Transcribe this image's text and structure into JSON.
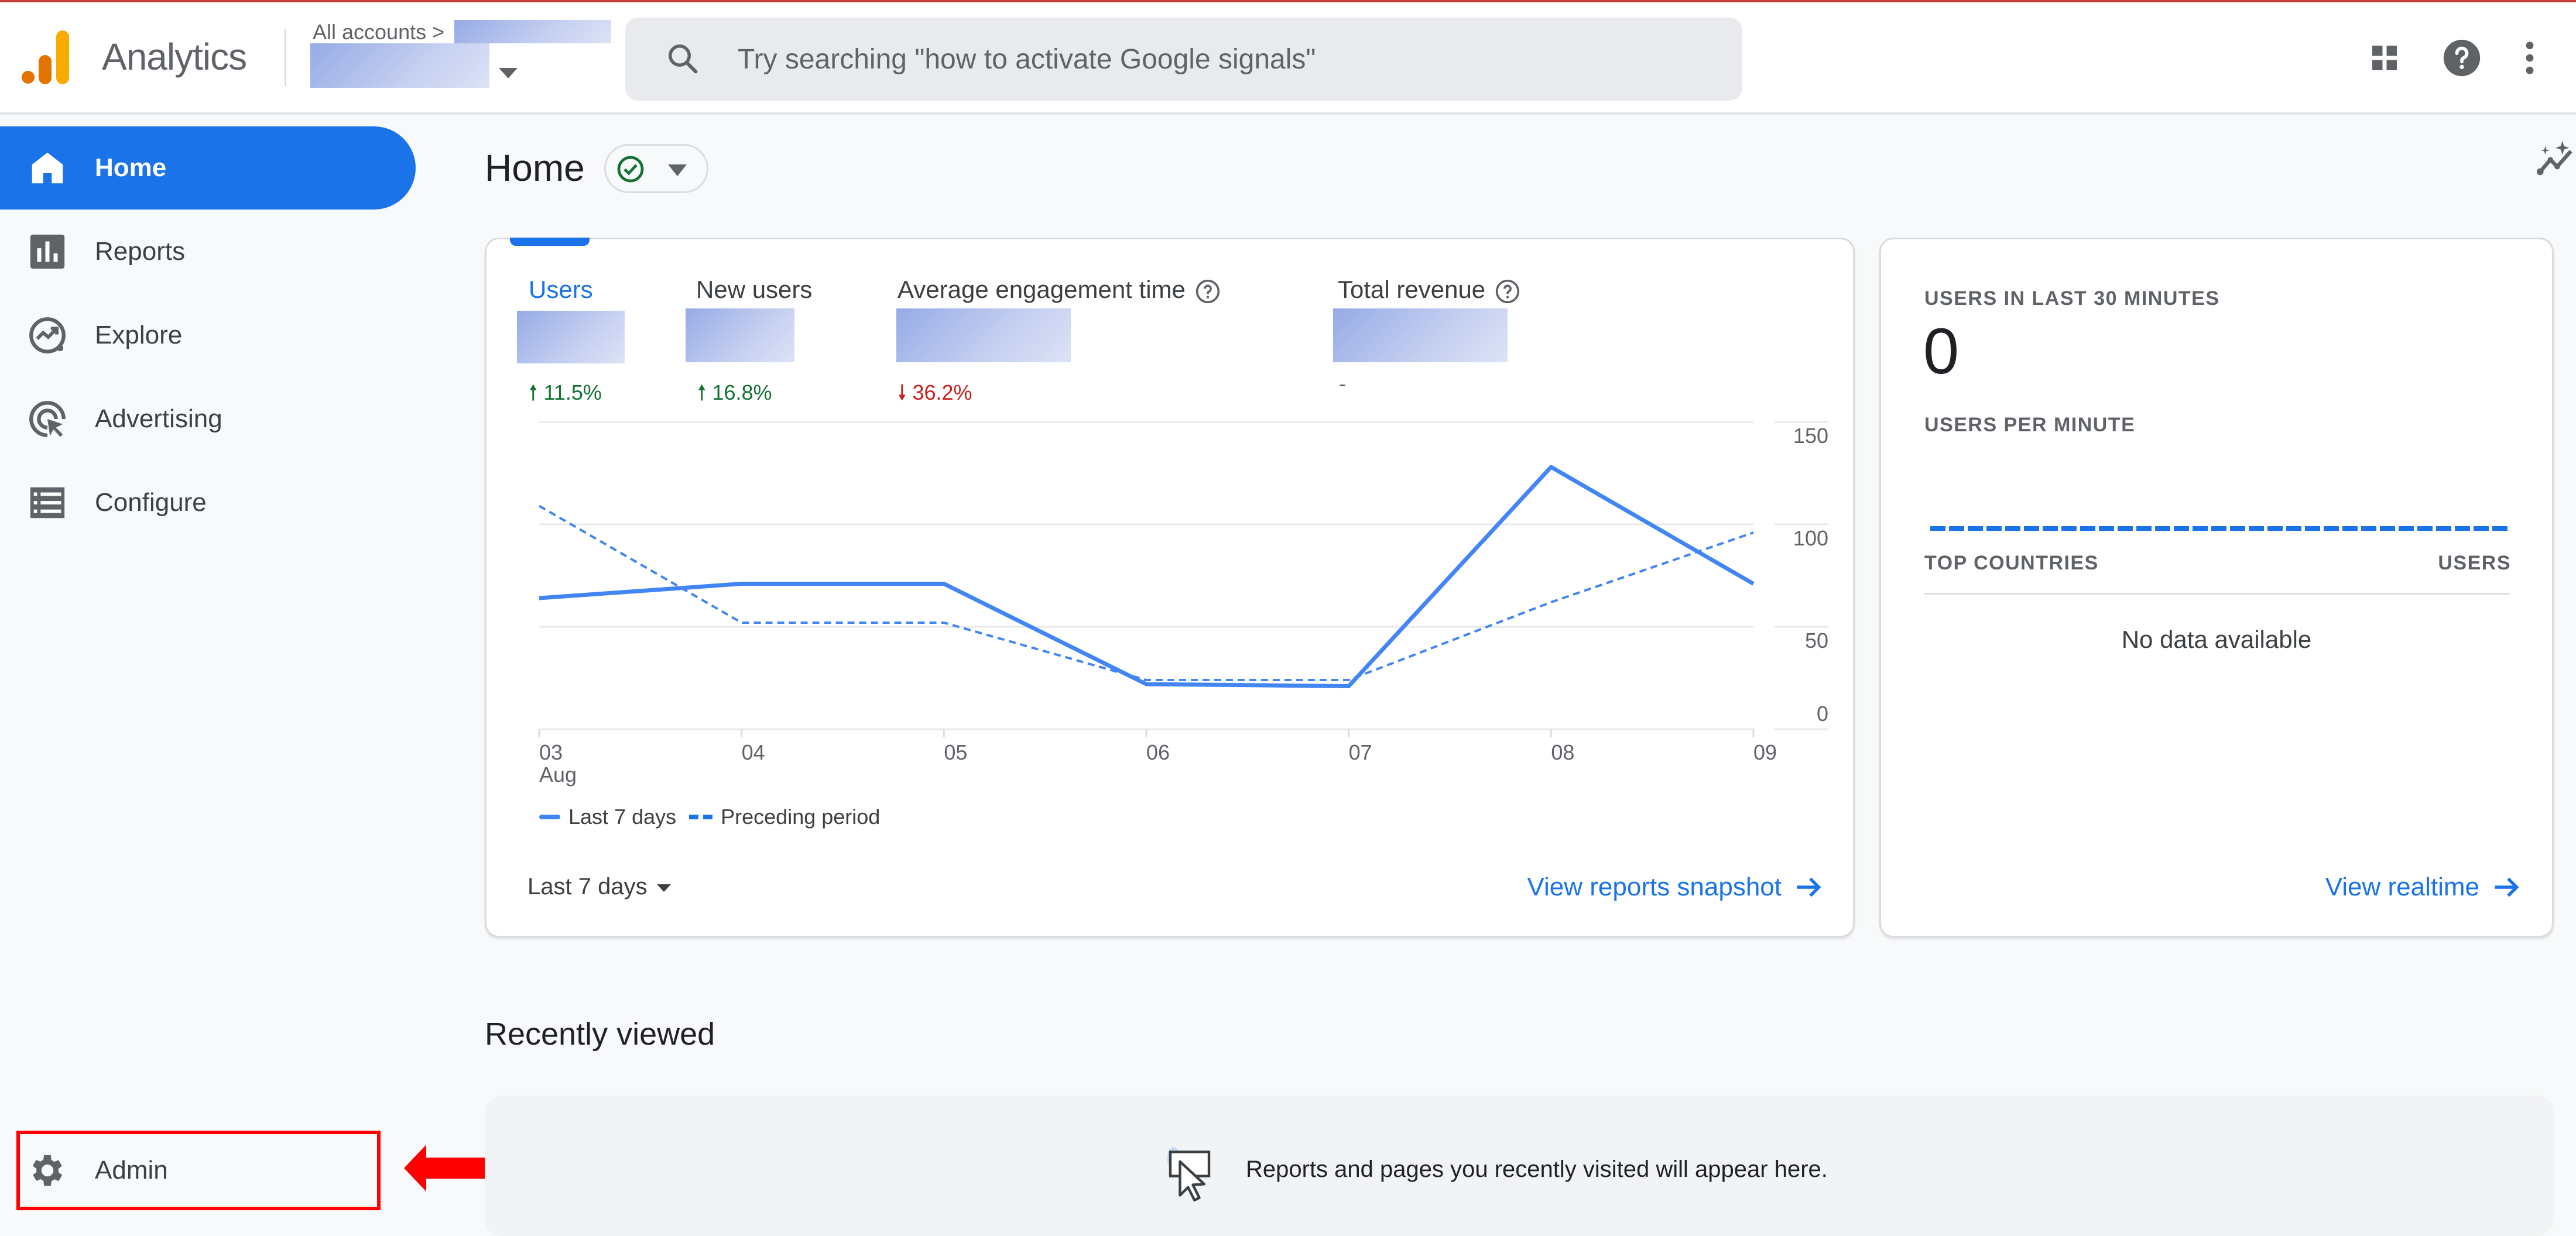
{
  "header": {
    "app_title": "Analytics",
    "breadcrumb": "All accounts >",
    "search_placeholder": "Try searching \"how to activate Google signals\"",
    "icons": [
      "apps-grid-icon",
      "help-icon",
      "more-vert-icon"
    ]
  },
  "sidebar": {
    "items": [
      {
        "label": "Home",
        "icon": "home-icon",
        "active": true
      },
      {
        "label": "Reports",
        "icon": "bar-chart-icon",
        "active": false
      },
      {
        "label": "Explore",
        "icon": "explore-icon",
        "active": false
      },
      {
        "label": "Advertising",
        "icon": "advertising-icon",
        "active": false
      },
      {
        "label": "Configure",
        "icon": "list-icon",
        "active": false
      }
    ],
    "admin": {
      "label": "Admin",
      "icon": "gear-icon"
    }
  },
  "main": {
    "title": "Home",
    "status": "check-circle-icon",
    "metrics": [
      {
        "label": "Users",
        "change": "11.5%",
        "direction": "up",
        "active": true
      },
      {
        "label": "New users",
        "change": "16.8%",
        "direction": "up",
        "active": false
      },
      {
        "label": "Average engagement time",
        "change": "36.2%",
        "direction": "down",
        "active": false,
        "help": true
      },
      {
        "label": "Total revenue",
        "change": "-",
        "direction": "none",
        "active": false,
        "help": true
      }
    ],
    "date_range": "Last 7 days",
    "view_snapshot": "View reports snapshot",
    "colors": {
      "accent": "#1a73e8",
      "up": "#137333",
      "down": "#c5221f",
      "line": "#4285f4"
    }
  },
  "chart_data": {
    "type": "line",
    "title": "",
    "x": [
      "03",
      "04",
      "05",
      "06",
      "07",
      "08",
      "09"
    ],
    "x_sublabel": "Aug",
    "ylabel": "",
    "ylim": [
      0,
      150
    ],
    "yticks": [
      0,
      50,
      100,
      150
    ],
    "y_axis_side": "right",
    "grid": true,
    "legend_position": "bottom-left",
    "series": [
      {
        "name": "Last 7 days",
        "style": "solid",
        "values": [
          64,
          71,
          71,
          22,
          21,
          128,
          71
        ]
      },
      {
        "name": "Preceding period",
        "style": "dashed",
        "values": [
          109,
          52,
          52,
          24,
          24,
          62,
          96
        ]
      }
    ]
  },
  "realtime": {
    "users_label": "USERS IN LAST 30 MINUTES",
    "users_value": "0",
    "per_minute_label": "USERS PER MINUTE",
    "top_countries_label": "TOP COUNTRIES",
    "users_col_label": "USERS",
    "no_data": "No data available",
    "view_realtime": "View realtime"
  },
  "recently_viewed": {
    "title": "Recently viewed",
    "message": "Reports and pages you recently visited will appear here."
  }
}
